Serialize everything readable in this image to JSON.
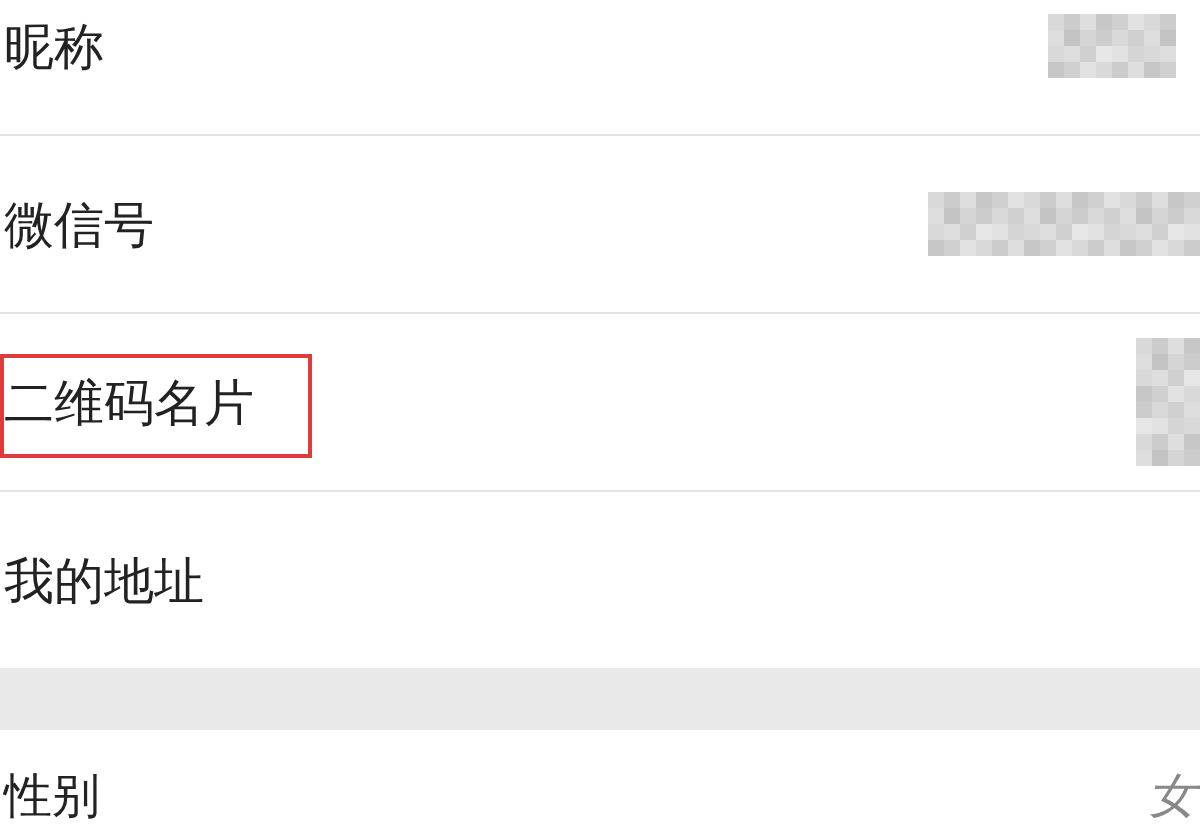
{
  "sections": [
    {
      "rows": [
        {
          "label": "昵称",
          "kind": "masked-short",
          "highlighted": false
        },
        {
          "label": "微信号",
          "kind": "masked-long",
          "highlighted": false
        },
        {
          "label": "二维码名片",
          "kind": "masked-image",
          "highlighted": true
        },
        {
          "label": "我的地址",
          "kind": "plain",
          "highlighted": false
        }
      ]
    },
    {
      "rows": [
        {
          "label": "性别",
          "kind": "value",
          "value": "女",
          "highlighted": false
        }
      ]
    }
  ]
}
